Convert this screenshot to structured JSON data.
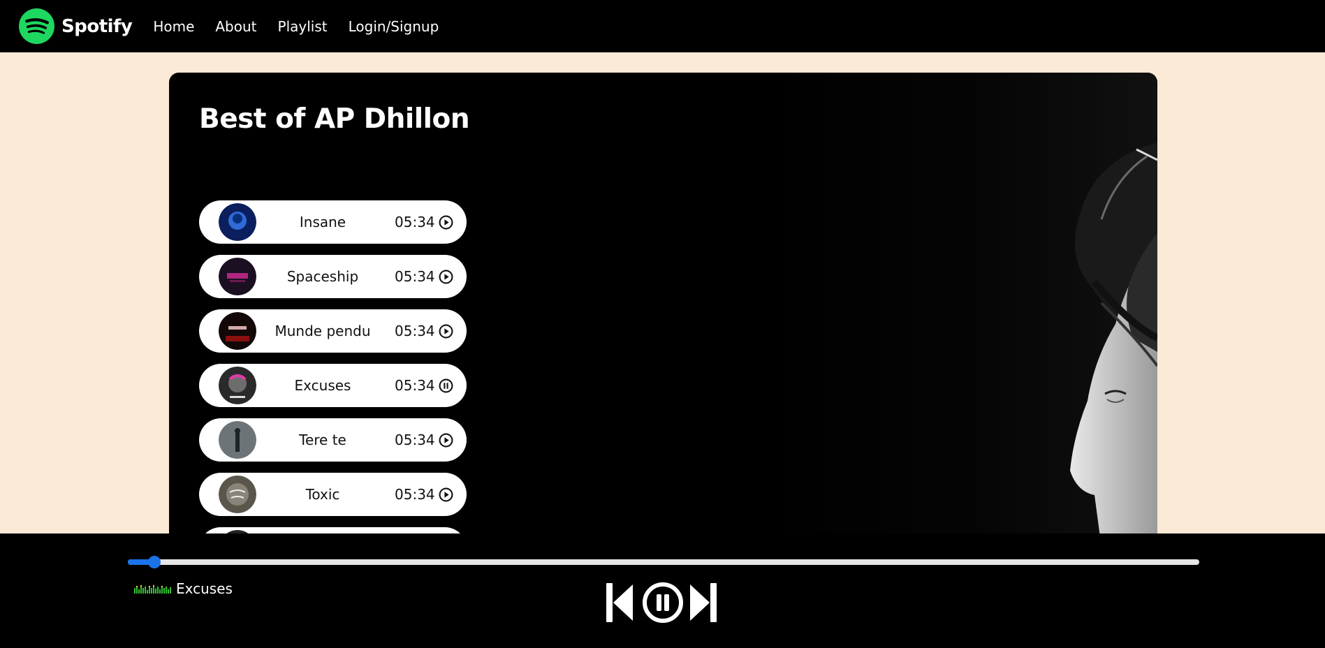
{
  "navbar": {
    "brand": "Spotify",
    "links": [
      "Home",
      "About",
      "Playlist",
      "Login/Signup"
    ]
  },
  "playlist": {
    "title": "Best of AP Dhillon",
    "songs": [
      {
        "name": "Insane",
        "duration": "05:34",
        "state": "play"
      },
      {
        "name": "Spaceship",
        "duration": "05:34",
        "state": "play"
      },
      {
        "name": "Munde pendu",
        "duration": "05:34",
        "state": "play"
      },
      {
        "name": "Excuses",
        "duration": "05:34",
        "state": "pause"
      },
      {
        "name": "Tere te",
        "duration": "05:34",
        "state": "play"
      },
      {
        "name": "Toxic",
        "duration": "05:34",
        "state": "play"
      }
    ]
  },
  "player": {
    "now_playing": "Excuses",
    "progress": 0.025,
    "icons": [
      "equalizer-icon",
      "previous-icon",
      "pause-icon",
      "next-icon"
    ]
  },
  "colors": {
    "background": "#fbead6",
    "brand_green": "#1ed760",
    "accent_blue": "#1a73e8"
  }
}
